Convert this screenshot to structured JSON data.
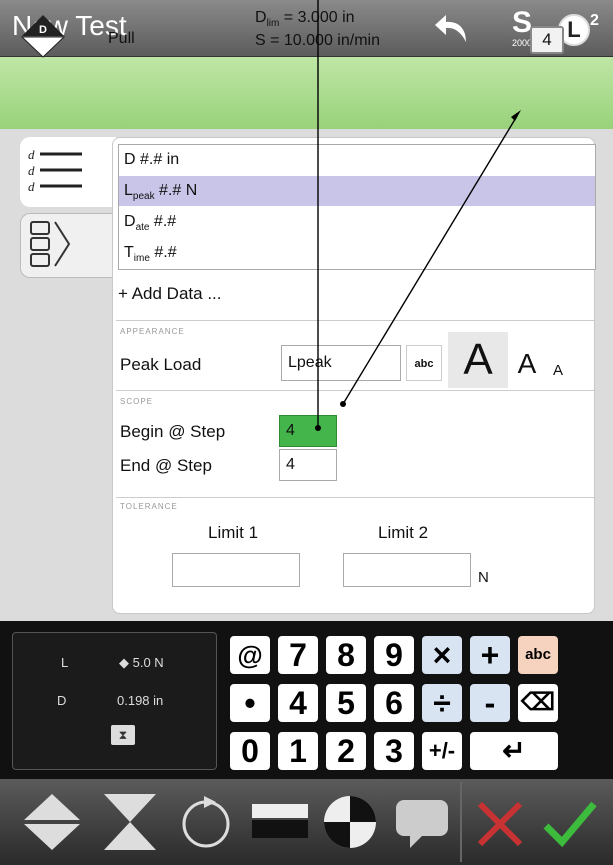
{
  "header": {
    "title": "New Test",
    "s_label": "S",
    "s_value": "2000",
    "l_label": "L",
    "l_superscript": "2"
  },
  "test": {
    "type": "Pull",
    "dlim_prefix": "D",
    "dlim_sub": "lim",
    "dlim_value": " = 3.000 in",
    "speed": "S = 10.000 in/min",
    "step": "4"
  },
  "data_list": {
    "rows": [
      {
        "main": "D",
        "sub": "",
        "value": "  #.# in"
      },
      {
        "main": "L",
        "sub": "peak",
        "value": "  #.# N"
      },
      {
        "main": "D",
        "sub": "ate",
        "value": "  #.#"
      },
      {
        "main": "T",
        "sub": "ime",
        "value": "  #.#"
      }
    ],
    "add_label": "+ Add Data ..."
  },
  "appearance": {
    "section": "APPEARANCE",
    "name_label": "Peak Load",
    "name_value": "Lpeak",
    "abc_label": "abc",
    "size_large": "A",
    "size_medium": "A",
    "size_small": "A"
  },
  "scope": {
    "section": "SCOPE",
    "begin_label": "Begin @ Step",
    "begin_value": "4",
    "end_label": "End @ Step",
    "end_value": "4"
  },
  "tolerance": {
    "section": "TOLERANCE",
    "limit1_label": "Limit 1",
    "limit2_label": "Limit 2",
    "unit": "N"
  },
  "status": {
    "l_label": "L",
    "l_value": "5.0 N",
    "d_label": "D",
    "d_value": "0.198 in"
  },
  "keypad": {
    "keys": [
      "@",
      "7",
      "8",
      "9",
      "×",
      "+",
      "abc",
      "•",
      "4",
      "5",
      "6",
      "÷",
      "-",
      "⌫",
      "0",
      "1",
      "2",
      "3",
      "+/-",
      "↵"
    ]
  },
  "colors": {
    "test_bar": "#a6d98a",
    "selected_row": "#c9c5e8",
    "active_input": "#44b54a",
    "accept": "#3dbb3d",
    "reject": "#c83232"
  }
}
